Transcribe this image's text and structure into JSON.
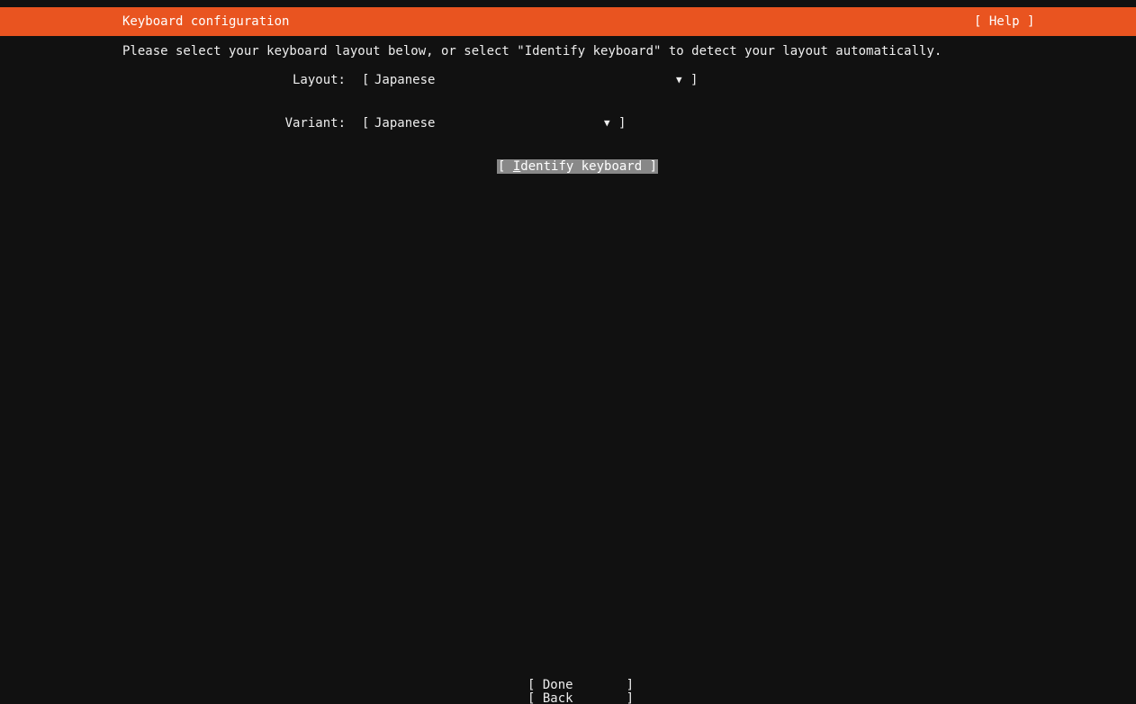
{
  "header": {
    "title": "Keyboard configuration",
    "help_label": "[ Help ]"
  },
  "instructions": "Please select your keyboard layout below, or select \"Identify keyboard\" to detect your layout automatically.",
  "layout": {
    "label": "Layout:",
    "open": "[",
    "value": "Japanese",
    "arrow": "▼",
    "close": "]"
  },
  "variant": {
    "label": "Variant:",
    "open": "[",
    "value": "Japanese",
    "arrow": "▼",
    "close": "]"
  },
  "identify_button": {
    "prefix": "[ ",
    "hotkey": "I",
    "rest": "dentify keyboard ]"
  },
  "footer": {
    "done_label": "[ Done       ]",
    "back_label": "[ Back       ]"
  },
  "colors": {
    "accent": "#e95420",
    "background": "#111111",
    "focus": "#888888"
  }
}
